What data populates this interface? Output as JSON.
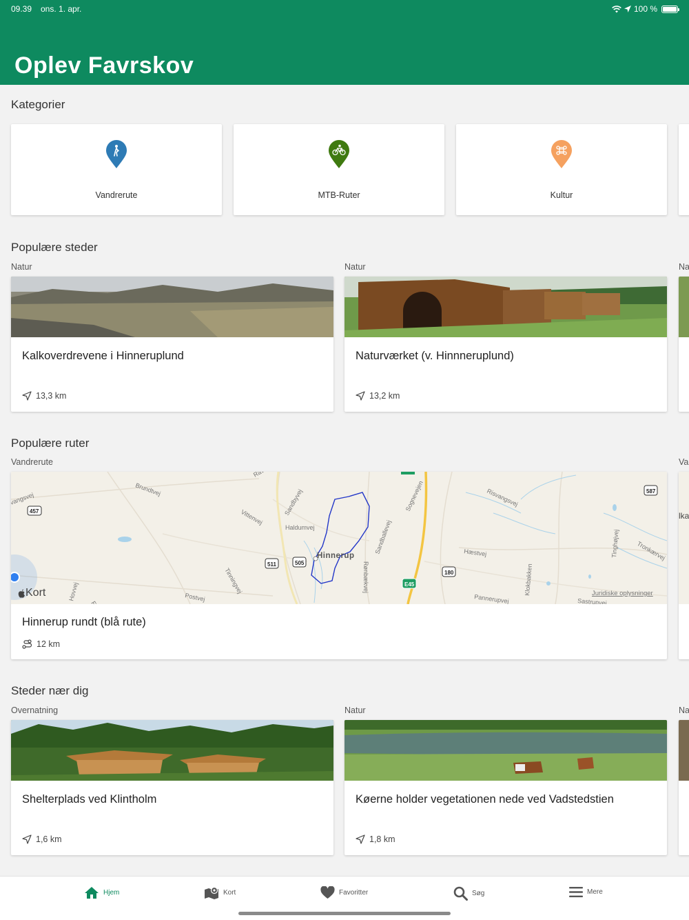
{
  "status_bar": {
    "time": "09.39",
    "date": "ons. 1. apr.",
    "battery": "100 %"
  },
  "header": {
    "title": "Oplev Favrskov",
    "color": "#0e8a5f"
  },
  "categories": {
    "title": "Kategorier",
    "items": [
      {
        "label": "Vandrerute",
        "icon": "hiker-pin-icon",
        "color": "#2e7bb5"
      },
      {
        "label": "MTB-Ruter",
        "icon": "bike-pin-icon",
        "color": "#3f7a10"
      },
      {
        "label": "Kultur",
        "icon": "culture-pin-icon",
        "color": "#f5a15f"
      }
    ]
  },
  "popular_places": {
    "title": "Populære steder",
    "items": [
      {
        "category": "Natur",
        "title": "Kalkoverdrevene i Hinneruplund",
        "distance": "13,3 km"
      },
      {
        "category": "Natur",
        "title": "Naturværket (v. Hinnneruplund)",
        "distance": "13,2 km"
      },
      {
        "category": "Na"
      }
    ]
  },
  "popular_routes": {
    "title": "Populære ruter",
    "items": [
      {
        "category": "Vandrerute",
        "title": "Hinnerup rundt (blå rute)",
        "distance": "12 km",
        "map": {
          "watermark": "Kort",
          "legal": "Juridiske oplysninger",
          "town": "Hinnerup",
          "roads": [
            "Brundtvej",
            "Risvangsvej",
            "Vittenvej",
            "Sandbyvej",
            "Haldumvej",
            "Sognevejen",
            "Sandballevej",
            "Hæstvej",
            "Tinghøjvej",
            "Tronkærvej",
            "Tinningvej",
            "Rønbækvej",
            "Klokbakken",
            "Postvej",
            "Pannerupvej",
            "Hovvej",
            "Sastrupvej",
            "vangsvej",
            "Rav",
            "Fur"
          ],
          "shields": [
            "457",
            "511",
            "505",
            "180",
            "E45",
            "587"
          ]
        }
      },
      {
        "category": "Va",
        "partial_text": "lka"
      }
    ]
  },
  "nearby": {
    "title": "Steder nær dig",
    "items": [
      {
        "category": "Overnatning",
        "title": "Shelterplads ved Klintholm",
        "distance": "1,6 km"
      },
      {
        "category": "Natur",
        "title": "Køerne holder vegetationen nede ved Vadstedstien",
        "distance": "1,8 km"
      },
      {
        "category": "Na"
      }
    ]
  },
  "tabs": [
    {
      "label": "Hjem",
      "icon": "home-icon",
      "active": true
    },
    {
      "label": "Kort",
      "icon": "map-icon",
      "active": false
    },
    {
      "label": "Favoritter",
      "icon": "heart-icon",
      "active": false
    },
    {
      "label": "Søg",
      "icon": "search-icon",
      "active": false
    },
    {
      "label": "Mere",
      "icon": "menu-icon",
      "active": false
    }
  ]
}
